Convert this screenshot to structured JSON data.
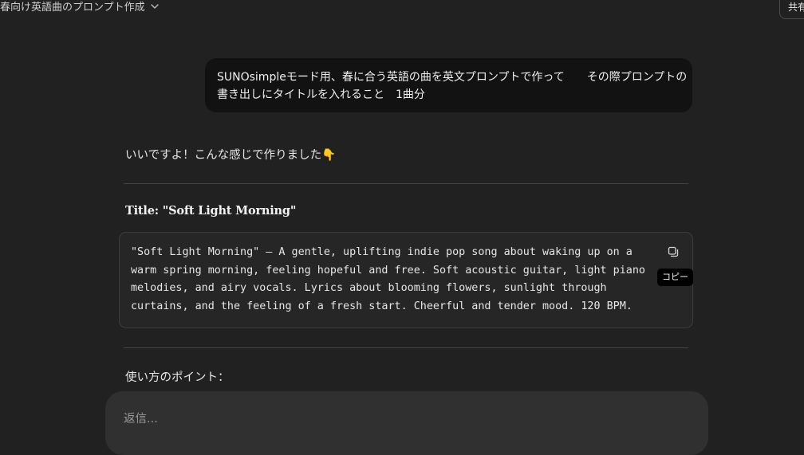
{
  "header": {
    "chat_title": "春向け英語曲のプロンプト作成",
    "chevron_icon": "chevron-down-icon",
    "share_label": "共有"
  },
  "conversation": {
    "user_message": {
      "line1": "SUNOsimpleモード用、春に合う英語の曲を英文プロンプトで作って　　その際プロンプトの",
      "line2": "書き出しにタイトルを入れること　1曲分"
    },
    "assistant": {
      "intro": "いいですよ！こんな感じで作りました👇",
      "prompt_title": "Title: \"Soft Light Morning\"",
      "code_lines": [
        "\"Soft Light Morning\" — A gentle, uplifting indie pop song about waking up on a",
        "warm spring morning, feeling hopeful and free. Soft acoustic guitar, light piano",
        "melodies, and airy vocals. Lyrics about blooming flowers, sunlight through",
        "curtains, and the feeling of a fresh start. Cheerful and tender mood. 120 BPM."
      ],
      "copy_icon": "copy-icon",
      "copy_tooltip": "コピー",
      "points_heading": "使い方のポイント："
    }
  },
  "composer": {
    "placeholder": "返信..."
  },
  "colors": {
    "background": "#212121",
    "user_bubble": "#121212",
    "code_block": "#262626",
    "composer": "#303030"
  }
}
